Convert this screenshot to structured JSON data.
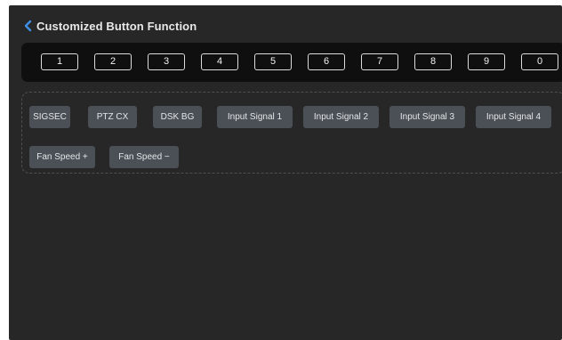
{
  "header": {
    "title": "Customized Button Function"
  },
  "number_keys": [
    "1",
    "2",
    "3",
    "4",
    "5",
    "6",
    "7",
    "8",
    "9",
    "0"
  ],
  "functions": {
    "row1": [
      "SIGSEC",
      "PTZ CX",
      "DSK BG",
      "Input Signal 1",
      "Input Signal 2",
      "Input Signal 3",
      "Input Signal 4"
    ],
    "row2": [
      "Fan Speed +",
      "Fan Speed −"
    ]
  },
  "colors": {
    "background": "#272727",
    "number_bar": "#0f0f0f",
    "function_button": "#4a5056",
    "back_icon": "#3d8fe8"
  }
}
